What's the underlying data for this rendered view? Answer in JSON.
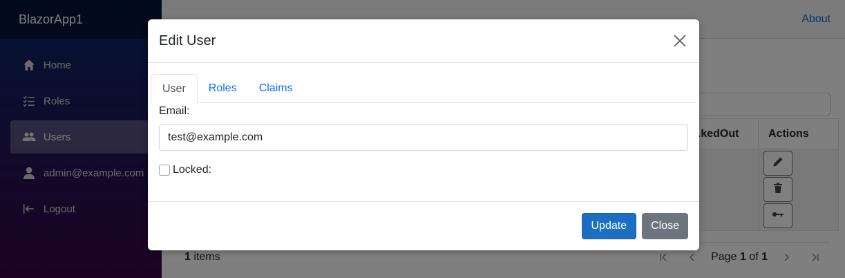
{
  "app": {
    "brand": "BlazorApp1"
  },
  "sidebar": {
    "items": [
      {
        "label": "Home",
        "icon": "home-icon",
        "active": false
      },
      {
        "label": "Roles",
        "icon": "list-icon",
        "active": false
      },
      {
        "label": "Users",
        "icon": "people-icon",
        "active": true
      },
      {
        "label": "admin@example.com",
        "icon": "person-icon",
        "active": false
      },
      {
        "label": "Logout",
        "icon": "logout-icon",
        "active": false
      }
    ]
  },
  "topbar": {
    "about": "About"
  },
  "grid": {
    "columns": [
      "...kedOut",
      "Actions"
    ],
    "actions": [
      "edit-icon",
      "trash-icon",
      "key-icon"
    ]
  },
  "pager": {
    "count": "1",
    "items_label": "items",
    "page_label": "Page",
    "current": "1",
    "of_label": "of",
    "total": "1"
  },
  "modal": {
    "title": "Edit User",
    "tabs": [
      {
        "label": "User",
        "active": true
      },
      {
        "label": "Roles",
        "active": false
      },
      {
        "label": "Claims",
        "active": false
      }
    ],
    "email_label": "Email:",
    "email_value": "test@example.com",
    "locked_label": "Locked:",
    "locked_checked": false,
    "update_label": "Update",
    "close_label": "Close"
  },
  "colors": {
    "primary": "#1b6ec2",
    "secondary": "#6c757d",
    "link": "#0d6efd",
    "sidebar_top": "#052767",
    "sidebar_bottom": "#3a0647"
  }
}
